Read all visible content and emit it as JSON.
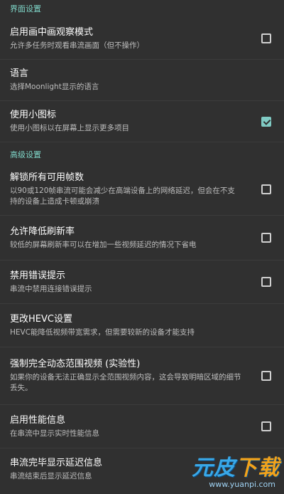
{
  "sections": [
    {
      "header": "界面设置",
      "items": [
        {
          "title": "启用画中画观察模式",
          "summary": "允许多任务时观看串流画面（但不操作）",
          "checkbox": true,
          "checked": false
        },
        {
          "title": "语言",
          "summary": "选择Moonlight显示的语言",
          "checkbox": false
        },
        {
          "title": "使用小图标",
          "summary": "使用小图标以在屏幕上显示更多项目",
          "checkbox": true,
          "checked": true
        }
      ]
    },
    {
      "header": "高级设置",
      "items": [
        {
          "title": "解锁所有可用帧数",
          "summary": "以90或120帧串流可能会减少在高端设备上的网络延迟，但会在不支持的设备上造成卡顿或崩溃",
          "checkbox": true,
          "checked": false
        },
        {
          "title": "允许降低刷新率",
          "summary": "较低的屏幕刷新率可以在增加一些视频延迟的情况下省电",
          "checkbox": true,
          "checked": false
        },
        {
          "title": "禁用错误提示",
          "summary": "串流中禁用连接错误提示",
          "checkbox": true,
          "checked": false
        },
        {
          "title": "更改HEVC设置",
          "summary": "HEVC能降低视频带宽需求，但需要较新的设备才能支持",
          "checkbox": false
        },
        {
          "title": "强制完全动态范围视频 (实验性)",
          "summary": "如果你的设备无法正确显示全范围视频内容，这会导致明暗区域的细节丢失。",
          "checkbox": true,
          "checked": false
        },
        {
          "title": "启用性能信息",
          "summary": "在串流中显示实时性能信息",
          "checkbox": true,
          "checked": false
        },
        {
          "title": "串流完毕显示延迟信息",
          "summary": "串流结束后显示延迟信息",
          "checkbox": false
        }
      ]
    }
  ],
  "watermark": {
    "brand_main": "元皮",
    "brand_accent": "下载",
    "url": "www.yuanpi.com"
  },
  "colors": {
    "background": "#303030",
    "accent": "#80cbc4",
    "header": "#7fd6c8"
  }
}
